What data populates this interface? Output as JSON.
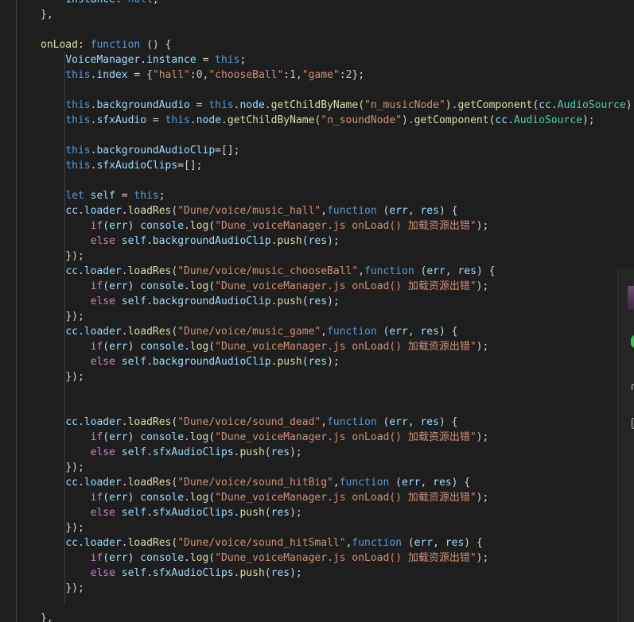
{
  "editor": {
    "language": "javascript",
    "lines": [
      [
        [
          "    ",
          "pun"
        ],
        [
          "instance",
          "var"
        ],
        [
          ": ",
          "pun"
        ],
        [
          "null",
          "kw"
        ],
        [
          ",",
          "pun"
        ]
      ],
      [
        [
          "},",
          "pun"
        ]
      ],
      [
        [
          "",
          "pun"
        ]
      ],
      [
        [
          "onLoad",
          "fn"
        ],
        [
          ": ",
          "pun"
        ],
        [
          "function",
          "kw"
        ],
        [
          " () {",
          "pun"
        ]
      ],
      [
        [
          "    ",
          "pun"
        ],
        [
          "VoiceManager",
          "var"
        ],
        [
          ".",
          "pun"
        ],
        [
          "instance",
          "var"
        ],
        [
          " = ",
          "pun"
        ],
        [
          "this",
          "kw"
        ],
        [
          ";",
          "pun"
        ]
      ],
      [
        [
          "    ",
          "pun"
        ],
        [
          "this",
          "kw"
        ],
        [
          ".",
          "pun"
        ],
        [
          "index",
          "var"
        ],
        [
          " = {",
          "pun"
        ],
        [
          "\"hall\"",
          "str"
        ],
        [
          ":",
          "pun"
        ],
        [
          "0",
          "num"
        ],
        [
          ",",
          "pun"
        ],
        [
          "\"chooseBall\"",
          "str"
        ],
        [
          ":",
          "pun"
        ],
        [
          "1",
          "num"
        ],
        [
          ",",
          "pun"
        ],
        [
          "\"game\"",
          "str"
        ],
        [
          ":",
          "pun"
        ],
        [
          "2",
          "num"
        ],
        [
          "};",
          "pun"
        ]
      ],
      [
        [
          "",
          "pun"
        ]
      ],
      [
        [
          "    ",
          "pun"
        ],
        [
          "this",
          "kw"
        ],
        [
          ".",
          "pun"
        ],
        [
          "backgroundAudio",
          "var"
        ],
        [
          " = ",
          "pun"
        ],
        [
          "this",
          "kw"
        ],
        [
          ".",
          "pun"
        ],
        [
          "node",
          "var"
        ],
        [
          ".",
          "pun"
        ],
        [
          "getChildByName",
          "fn"
        ],
        [
          "(",
          "pun"
        ],
        [
          "\"n_musicNode\"",
          "str"
        ],
        [
          ").",
          "pun"
        ],
        [
          "getComponent",
          "fn"
        ],
        [
          "(",
          "pun"
        ],
        [
          "cc",
          "var"
        ],
        [
          ".",
          "pun"
        ],
        [
          "AudioSource",
          "cls"
        ],
        [
          ");",
          "pun"
        ]
      ],
      [
        [
          "    ",
          "pun"
        ],
        [
          "this",
          "kw"
        ],
        [
          ".",
          "pun"
        ],
        [
          "sfxAudio",
          "var"
        ],
        [
          " = ",
          "pun"
        ],
        [
          "this",
          "kw"
        ],
        [
          ".",
          "pun"
        ],
        [
          "node",
          "var"
        ],
        [
          ".",
          "pun"
        ],
        [
          "getChildByName",
          "fn"
        ],
        [
          "(",
          "pun"
        ],
        [
          "\"n_soundNode\"",
          "str"
        ],
        [
          ").",
          "pun"
        ],
        [
          "getComponent",
          "fn"
        ],
        [
          "(",
          "pun"
        ],
        [
          "cc",
          "var"
        ],
        [
          ".",
          "pun"
        ],
        [
          "AudioSource",
          "cls"
        ],
        [
          ");",
          "pun"
        ]
      ],
      [
        [
          "",
          "pun"
        ]
      ],
      [
        [
          "    ",
          "pun"
        ],
        [
          "this",
          "kw"
        ],
        [
          ".",
          "pun"
        ],
        [
          "backgroundAudioClip",
          "var"
        ],
        [
          "=[];",
          "pun"
        ]
      ],
      [
        [
          "    ",
          "pun"
        ],
        [
          "this",
          "kw"
        ],
        [
          ".",
          "pun"
        ],
        [
          "sfxAudioClips",
          "var"
        ],
        [
          "=[];",
          "pun"
        ]
      ],
      [
        [
          "",
          "pun"
        ]
      ],
      [
        [
          "    ",
          "pun"
        ],
        [
          "let",
          "kw"
        ],
        [
          " ",
          "pun"
        ],
        [
          "self",
          "var"
        ],
        [
          " = ",
          "pun"
        ],
        [
          "this",
          "kw"
        ],
        [
          ";",
          "pun"
        ]
      ],
      [
        [
          "    ",
          "pun"
        ],
        [
          "cc",
          "var"
        ],
        [
          ".",
          "pun"
        ],
        [
          "loader",
          "var"
        ],
        [
          ".",
          "pun"
        ],
        [
          "loadRes",
          "fn"
        ],
        [
          "(",
          "pun"
        ],
        [
          "\"Dune/voice/music_hall\"",
          "str"
        ],
        [
          ",",
          "pun"
        ],
        [
          "function",
          "kw"
        ],
        [
          " (",
          "pun"
        ],
        [
          "err",
          "var"
        ],
        [
          ", ",
          "pun"
        ],
        [
          "res",
          "var"
        ],
        [
          ") {",
          "pun"
        ]
      ],
      [
        [
          "        ",
          "pun"
        ],
        [
          "if",
          "ctl"
        ],
        [
          "(",
          "pun"
        ],
        [
          "err",
          "var"
        ],
        [
          ") ",
          "pun"
        ],
        [
          "console",
          "var"
        ],
        [
          ".",
          "pun"
        ],
        [
          "log",
          "fn"
        ],
        [
          "(",
          "pun"
        ],
        [
          "\"Dune_voiceManager.js onLoad() 加载资源出错\"",
          "str"
        ],
        [
          ");",
          "pun"
        ]
      ],
      [
        [
          "        ",
          "pun"
        ],
        [
          "else",
          "ctl"
        ],
        [
          " ",
          "pun"
        ],
        [
          "self",
          "var"
        ],
        [
          ".",
          "pun"
        ],
        [
          "backgroundAudioClip",
          "var"
        ],
        [
          ".",
          "pun"
        ],
        [
          "push",
          "fn"
        ],
        [
          "(",
          "pun"
        ],
        [
          "res",
          "var"
        ],
        [
          ");",
          "pun"
        ]
      ],
      [
        [
          "    ",
          "pun"
        ],
        [
          "});",
          "pun"
        ]
      ],
      [
        [
          "    ",
          "pun"
        ],
        [
          "cc",
          "var"
        ],
        [
          ".",
          "pun"
        ],
        [
          "loader",
          "var"
        ],
        [
          ".",
          "pun"
        ],
        [
          "loadRes",
          "fn"
        ],
        [
          "(",
          "pun"
        ],
        [
          "\"Dune/voice/music_chooseBall\"",
          "str"
        ],
        [
          ",",
          "pun"
        ],
        [
          "function",
          "kw"
        ],
        [
          " (",
          "pun"
        ],
        [
          "err",
          "var"
        ],
        [
          ", ",
          "pun"
        ],
        [
          "res",
          "var"
        ],
        [
          ") {",
          "pun"
        ]
      ],
      [
        [
          "        ",
          "pun"
        ],
        [
          "if",
          "ctl"
        ],
        [
          "(",
          "pun"
        ],
        [
          "err",
          "var"
        ],
        [
          ") ",
          "pun"
        ],
        [
          "console",
          "var"
        ],
        [
          ".",
          "pun"
        ],
        [
          "log",
          "fn"
        ],
        [
          "(",
          "pun"
        ],
        [
          "\"Dune_voiceManager.js onLoad() 加载资源出错\"",
          "str"
        ],
        [
          ");",
          "pun"
        ]
      ],
      [
        [
          "        ",
          "pun"
        ],
        [
          "else",
          "ctl"
        ],
        [
          " ",
          "pun"
        ],
        [
          "self",
          "var"
        ],
        [
          ".",
          "pun"
        ],
        [
          "backgroundAudioClip",
          "var"
        ],
        [
          ".",
          "pun"
        ],
        [
          "push",
          "fn"
        ],
        [
          "(",
          "pun"
        ],
        [
          "res",
          "var"
        ],
        [
          ");",
          "pun"
        ]
      ],
      [
        [
          "    ",
          "pun"
        ],
        [
          "});",
          "pun"
        ]
      ],
      [
        [
          "    ",
          "pun"
        ],
        [
          "cc",
          "var"
        ],
        [
          ".",
          "pun"
        ],
        [
          "loader",
          "var"
        ],
        [
          ".",
          "pun"
        ],
        [
          "loadRes",
          "fn"
        ],
        [
          "(",
          "pun"
        ],
        [
          "\"Dune/voice/music_game\"",
          "str"
        ],
        [
          ",",
          "pun"
        ],
        [
          "function",
          "kw"
        ],
        [
          " (",
          "pun"
        ],
        [
          "err",
          "var"
        ],
        [
          ", ",
          "pun"
        ],
        [
          "res",
          "var"
        ],
        [
          ") {",
          "pun"
        ]
      ],
      [
        [
          "        ",
          "pun"
        ],
        [
          "if",
          "ctl"
        ],
        [
          "(",
          "pun"
        ],
        [
          "err",
          "var"
        ],
        [
          ") ",
          "pun"
        ],
        [
          "console",
          "var"
        ],
        [
          ".",
          "pun"
        ],
        [
          "log",
          "fn"
        ],
        [
          "(",
          "pun"
        ],
        [
          "\"Dune_voiceManager.js onLoad() 加载资源出错\"",
          "str"
        ],
        [
          ");",
          "pun"
        ]
      ],
      [
        [
          "        ",
          "pun"
        ],
        [
          "else",
          "ctl"
        ],
        [
          " ",
          "pun"
        ],
        [
          "self",
          "var"
        ],
        [
          ".",
          "pun"
        ],
        [
          "backgroundAudioClip",
          "var"
        ],
        [
          ".",
          "pun"
        ],
        [
          "push",
          "fn"
        ],
        [
          "(",
          "pun"
        ],
        [
          "res",
          "var"
        ],
        [
          ");",
          "pun"
        ]
      ],
      [
        [
          "    ",
          "pun"
        ],
        [
          "});",
          "pun"
        ]
      ],
      [
        [
          "",
          "pun"
        ]
      ],
      [
        [
          "",
          "pun"
        ]
      ],
      [
        [
          "    ",
          "pun"
        ],
        [
          "cc",
          "var"
        ],
        [
          ".",
          "pun"
        ],
        [
          "loader",
          "var"
        ],
        [
          ".",
          "pun"
        ],
        [
          "loadRes",
          "fn"
        ],
        [
          "(",
          "pun"
        ],
        [
          "\"Dune/voice/sound_dead\"",
          "str"
        ],
        [
          ",",
          "pun"
        ],
        [
          "function",
          "kw"
        ],
        [
          " (",
          "pun"
        ],
        [
          "err",
          "var"
        ],
        [
          ", ",
          "pun"
        ],
        [
          "res",
          "var"
        ],
        [
          ") {",
          "pun"
        ]
      ],
      [
        [
          "        ",
          "pun"
        ],
        [
          "if",
          "ctl"
        ],
        [
          "(",
          "pun"
        ],
        [
          "err",
          "var"
        ],
        [
          ") ",
          "pun"
        ],
        [
          "console",
          "var"
        ],
        [
          ".",
          "pun"
        ],
        [
          "log",
          "fn"
        ],
        [
          "(",
          "pun"
        ],
        [
          "\"Dune_voiceManager.js onLoad() 加载资源出错\"",
          "str"
        ],
        [
          ");",
          "pun"
        ]
      ],
      [
        [
          "        ",
          "pun"
        ],
        [
          "else",
          "ctl"
        ],
        [
          " ",
          "pun"
        ],
        [
          "self",
          "var"
        ],
        [
          ".",
          "pun"
        ],
        [
          "sfxAudioClips",
          "var"
        ],
        [
          ".",
          "pun"
        ],
        [
          "push",
          "fn"
        ],
        [
          "(",
          "pun"
        ],
        [
          "res",
          "var"
        ],
        [
          ");",
          "pun"
        ]
      ],
      [
        [
          "    ",
          "pun"
        ],
        [
          "});",
          "pun"
        ]
      ],
      [
        [
          "    ",
          "pun"
        ],
        [
          "cc",
          "var"
        ],
        [
          ".",
          "pun"
        ],
        [
          "loader",
          "var"
        ],
        [
          ".",
          "pun"
        ],
        [
          "loadRes",
          "fn"
        ],
        [
          "(",
          "pun"
        ],
        [
          "\"Dune/voice/sound_hitBig\"",
          "str"
        ],
        [
          ",",
          "pun"
        ],
        [
          "function",
          "kw"
        ],
        [
          " (",
          "pun"
        ],
        [
          "err",
          "var"
        ],
        [
          ", ",
          "pun"
        ],
        [
          "res",
          "var"
        ],
        [
          ") {",
          "pun"
        ]
      ],
      [
        [
          "        ",
          "pun"
        ],
        [
          "if",
          "ctl"
        ],
        [
          "(",
          "pun"
        ],
        [
          "err",
          "var"
        ],
        [
          ") ",
          "pun"
        ],
        [
          "console",
          "var"
        ],
        [
          ".",
          "pun"
        ],
        [
          "log",
          "fn"
        ],
        [
          "(",
          "pun"
        ],
        [
          "\"Dune_voiceManager.js onLoad() 加载资源出错\"",
          "str"
        ],
        [
          ");",
          "pun"
        ]
      ],
      [
        [
          "        ",
          "pun"
        ],
        [
          "else",
          "ctl"
        ],
        [
          " ",
          "pun"
        ],
        [
          "self",
          "var"
        ],
        [
          ".",
          "pun"
        ],
        [
          "sfxAudioClips",
          "var"
        ],
        [
          ".",
          "pun"
        ],
        [
          "push",
          "fn"
        ],
        [
          "(",
          "pun"
        ],
        [
          "res",
          "var"
        ],
        [
          ");",
          "pun"
        ]
      ],
      [
        [
          "    ",
          "pun"
        ],
        [
          "});",
          "pun"
        ]
      ],
      [
        [
          "    ",
          "pun"
        ],
        [
          "cc",
          "var"
        ],
        [
          ".",
          "pun"
        ],
        [
          "loader",
          "var"
        ],
        [
          ".",
          "pun"
        ],
        [
          "loadRes",
          "fn"
        ],
        [
          "(",
          "pun"
        ],
        [
          "\"Dune/voice/sound_hitSmall\"",
          "str"
        ],
        [
          ",",
          "pun"
        ],
        [
          "function",
          "kw"
        ],
        [
          " (",
          "pun"
        ],
        [
          "err",
          "var"
        ],
        [
          ", ",
          "pun"
        ],
        [
          "res",
          "var"
        ],
        [
          ") {",
          "pun"
        ]
      ],
      [
        [
          "        ",
          "pun"
        ],
        [
          "if",
          "ctl"
        ],
        [
          "(",
          "pun"
        ],
        [
          "err",
          "var"
        ],
        [
          ") ",
          "pun"
        ],
        [
          "console",
          "var"
        ],
        [
          ".",
          "pun"
        ],
        [
          "log",
          "fn"
        ],
        [
          "(",
          "pun"
        ],
        [
          "\"Dune_voiceManager.js onLoad() 加载资源出错\"",
          "str"
        ],
        [
          ");",
          "pun"
        ]
      ],
      [
        [
          "        ",
          "pun"
        ],
        [
          "else",
          "ctl"
        ],
        [
          " ",
          "pun"
        ],
        [
          "self",
          "var"
        ],
        [
          ".",
          "pun"
        ],
        [
          "sfxAudioClips",
          "var"
        ],
        [
          ".",
          "pun"
        ],
        [
          "push",
          "fn"
        ],
        [
          "(",
          "pun"
        ],
        [
          "res",
          "var"
        ],
        [
          ");",
          "pun"
        ]
      ],
      [
        [
          "    ",
          "pun"
        ],
        [
          "});",
          "pun"
        ]
      ],
      [
        [
          "",
          "pun"
        ]
      ],
      [
        [
          "},",
          "pun"
        ]
      ]
    ]
  },
  "colors": {
    "background": "#1e1e1e",
    "keyword": "#569cd6",
    "control": "#c586c0",
    "function": "#dcdcaa",
    "string": "#ce9178",
    "number": "#b5cea8",
    "variable": "#9cdcfe",
    "class": "#4ec9b0",
    "punctuation": "#d4d4d4"
  }
}
